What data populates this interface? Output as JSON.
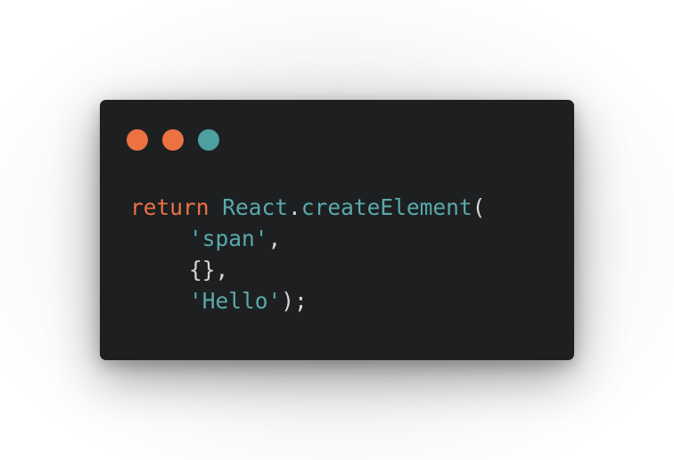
{
  "colors": {
    "window_bg": "#1d1f21",
    "dot_red": "#ec7242",
    "dot_yellow": "#ec7242",
    "dot_green": "#4d9fa0",
    "keyword": "#ec7242",
    "identifier": "#5aa9ab",
    "string": "#5aa9ab",
    "punctuation": "#d6d6d6"
  },
  "window": {
    "dots": [
      {
        "name": "close-dot",
        "color": "#ec7242"
      },
      {
        "name": "minimize-dot",
        "color": "#ec7242"
      },
      {
        "name": "maximize-dot",
        "color": "#4d9fa0"
      }
    ]
  },
  "code": {
    "line1": {
      "keyword": "return",
      "space": " ",
      "object": "React",
      "dot": ".",
      "method": "createElement",
      "paren": "("
    },
    "line2": {
      "string": "'span'",
      "comma": ","
    },
    "line3": {
      "braces": "{}",
      "comma": ","
    },
    "line4": {
      "string": "'Hello'",
      "close": ");"
    }
  }
}
